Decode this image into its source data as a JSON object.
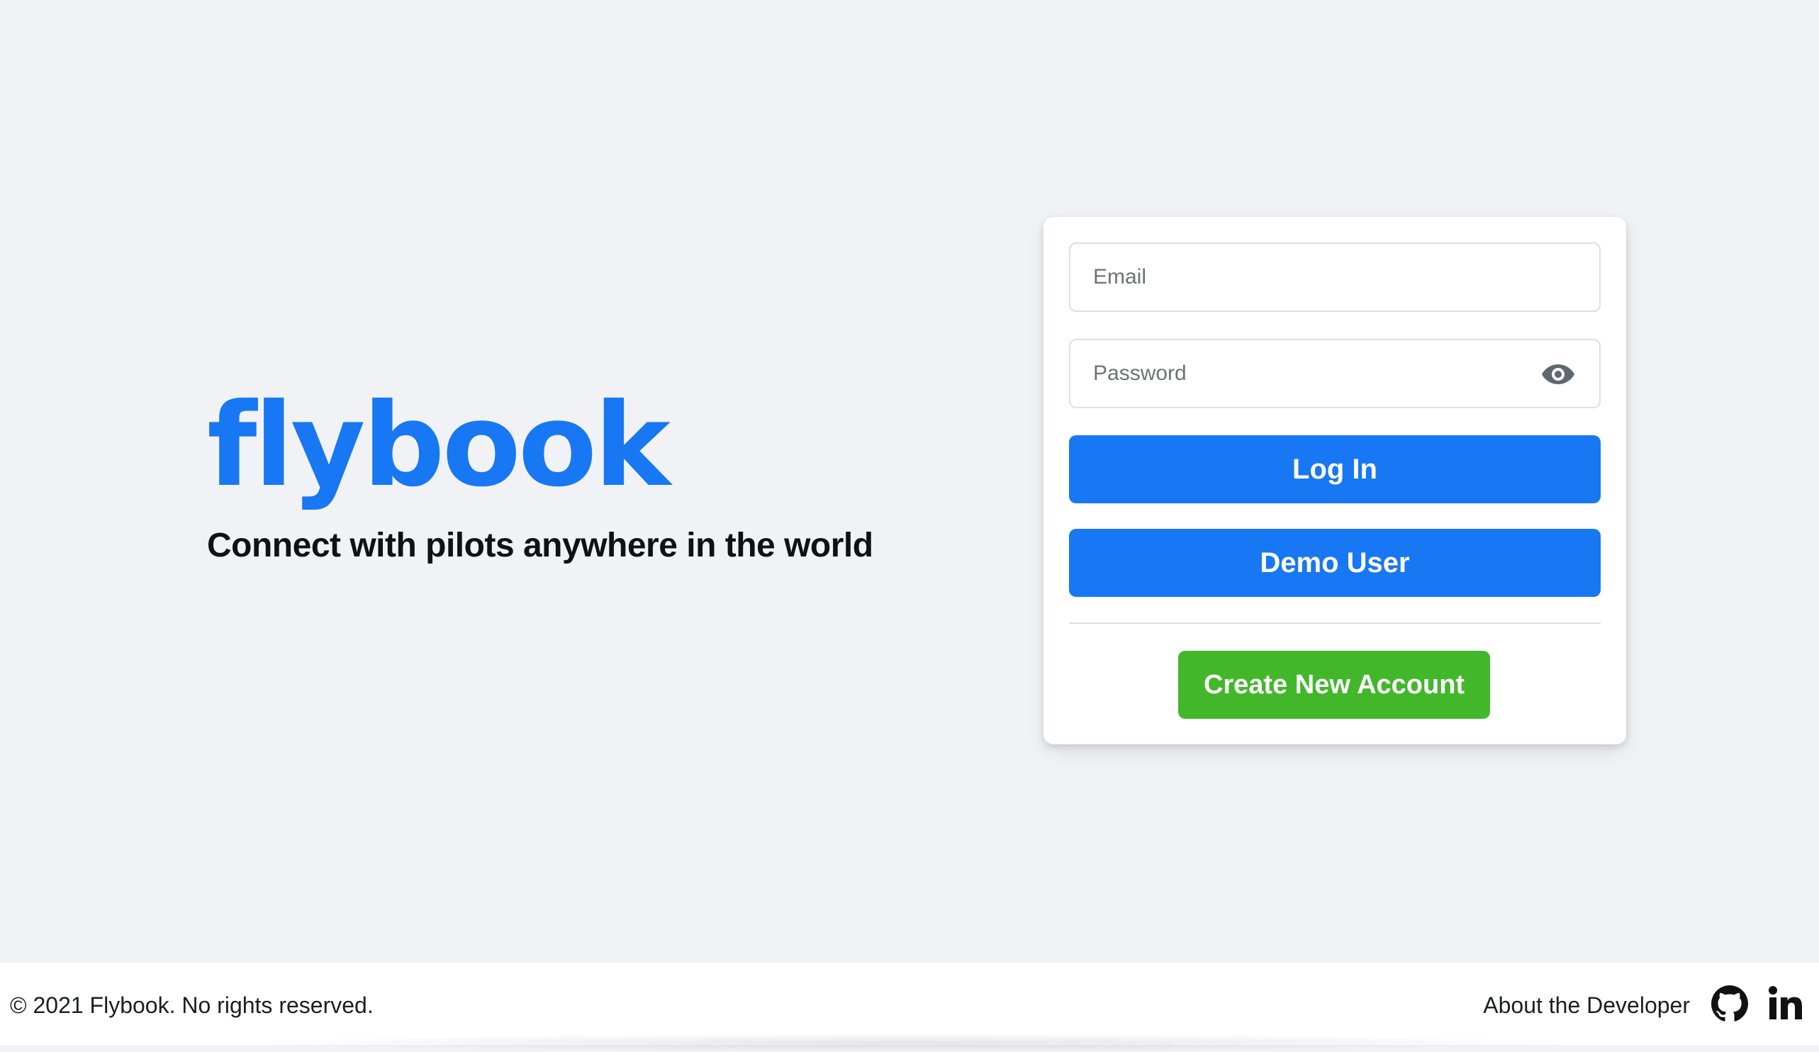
{
  "brand": {
    "logo": "flybook",
    "tagline": "Connect with pilots anywhere in the world"
  },
  "login_form": {
    "email": {
      "placeholder": "Email",
      "value": ""
    },
    "password": {
      "placeholder": "Password",
      "value": "",
      "toggle_icon": "eye-icon"
    },
    "login_label": "Log In",
    "demo_label": "Demo User",
    "create_label": "Create New Account"
  },
  "footer": {
    "copyright": "© 2021 Flybook. No rights reserved.",
    "about_label": "About the Developer",
    "links": [
      {
        "icon": "github-icon"
      },
      {
        "icon": "linkedin-icon"
      }
    ]
  },
  "colors": {
    "background": "#f0f2f5",
    "primary": "#1877f2",
    "create_green": "#42b72a",
    "text": "#1c1e21"
  }
}
